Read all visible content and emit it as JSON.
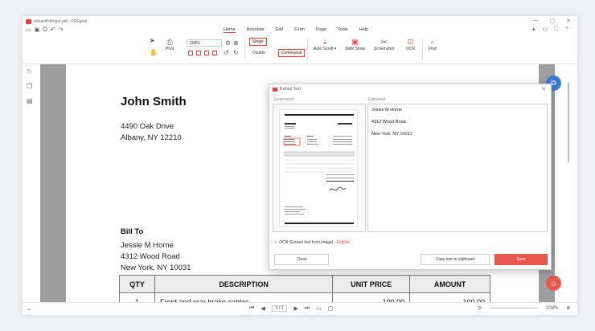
{
  "window": {
    "title": "extractPdfInput.pdf - PDFgear",
    "controls": [
      "—",
      "▢",
      "✕"
    ]
  },
  "menu": {
    "tabs": [
      "Home",
      "Annotate",
      "Edit",
      "Form",
      "Page",
      "Tools",
      "Help"
    ],
    "active_tab": "Home"
  },
  "ribbon": {
    "print_label": "Print",
    "zoom_value": "208%",
    "single_label": "Single",
    "double_label": "Double",
    "continuous_label": "Continuous",
    "auto_scroll_label": "Auto Scroll ▾",
    "slide_show_label": "Slide Show",
    "screenshot_label": "Screenshot",
    "ocr_label": "OCR",
    "find_label": "Find"
  },
  "document": {
    "name": "John Smith",
    "address_line1": "4490 Oak Drive",
    "address_line2": "Albany, NY 12210",
    "bill_to_heading": "Bill To",
    "bill_name": "Jessie M Horne",
    "bill_street": "4312 Wood Road",
    "bill_city": "New York, NY 10031",
    "table": {
      "headers": [
        "QTY",
        "DESCRIPTION",
        "UNIT PRICE",
        "AMOUNT"
      ],
      "rows": [
        [
          "1",
          "Front and rear brake cables",
          "100.00",
          "100.00"
        ]
      ]
    }
  },
  "dialog": {
    "title": "Extract Text",
    "screenshot_label": "Screenshot",
    "extracted_label": "Extracted",
    "extracted_lines": [
      "Jessie M Horne",
      "4312 Wood Road",
      "New York, NY 10031"
    ],
    "ocr_label": "OCR (Extract text from image)",
    "ocr_language": "English",
    "close_label": "Close",
    "copy_label": "Copy text to clipboard",
    "save_label": "Save"
  },
  "statusbar": {
    "page_display": "1 / 1",
    "zoom_display": "208%"
  },
  "colors": {
    "brand_red": "#e8423b",
    "save_button": "#e8574e",
    "doc_background": "#9e9e9e",
    "fab_blue": "#3a7bd5"
  },
  "icons": [
    "app-logo-icon",
    "save-icon",
    "print-icon",
    "undo-icon",
    "redo-icon",
    "select-arrow-icon",
    "hand-icon",
    "zoom-out-icon",
    "zoom-in-icon",
    "bookmark-icon",
    "pages-icon",
    "comment-icon",
    "scissors-icon",
    "ocr-icon",
    "find-icon",
    "ai-icon",
    "robot-icon"
  ]
}
